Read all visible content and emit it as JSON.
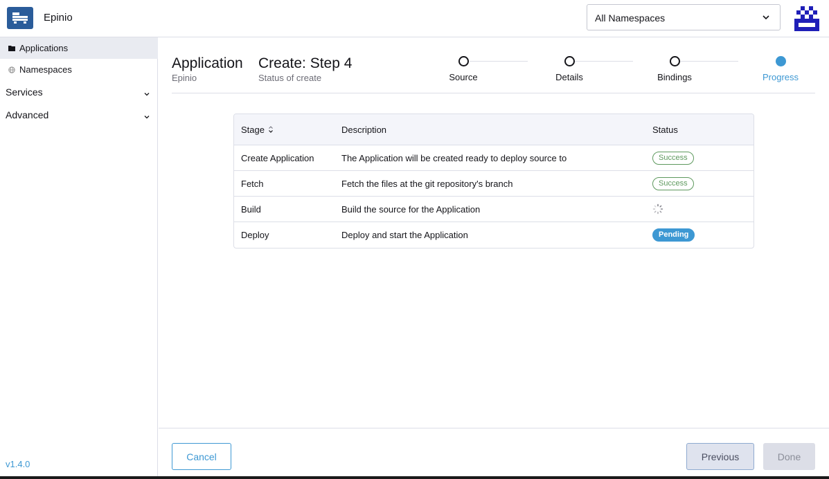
{
  "header": {
    "app_name": "Epinio",
    "namespace_select": "All Namespaces"
  },
  "sidebar": {
    "items": [
      {
        "label": "Applications",
        "icon": "folder-icon"
      },
      {
        "label": "Namespaces",
        "icon": "globe-icon"
      }
    ],
    "groups": [
      {
        "label": "Services"
      },
      {
        "label": "Advanced"
      }
    ],
    "version": "v1.4.0"
  },
  "page": {
    "title": "Application",
    "title_sub": "Epinio",
    "step_title": "Create: Step 4",
    "step_sub": "Status of create"
  },
  "stepper": {
    "steps": [
      {
        "label": "Source"
      },
      {
        "label": "Details"
      },
      {
        "label": "Bindings"
      },
      {
        "label": "Progress",
        "current": true
      }
    ]
  },
  "table": {
    "headers": [
      "Stage",
      "Description",
      "Status"
    ],
    "rows": [
      {
        "stage": "Create Application",
        "description": "The Application will be created ready to deploy source to",
        "status": "Success"
      },
      {
        "stage": "Fetch",
        "description": "Fetch the files at the git repository's branch",
        "status": "Success"
      },
      {
        "stage": "Build",
        "description": "Build the source for the Application",
        "status": "loading"
      },
      {
        "stage": "Deploy",
        "description": "Deploy and start the Application",
        "status": "Pending"
      }
    ]
  },
  "footer": {
    "cancel": "Cancel",
    "previous": "Previous",
    "done": "Done"
  },
  "colors": {
    "accent": "#3d98d3",
    "success": "#5d995d",
    "brand": "#2a5c9a"
  }
}
